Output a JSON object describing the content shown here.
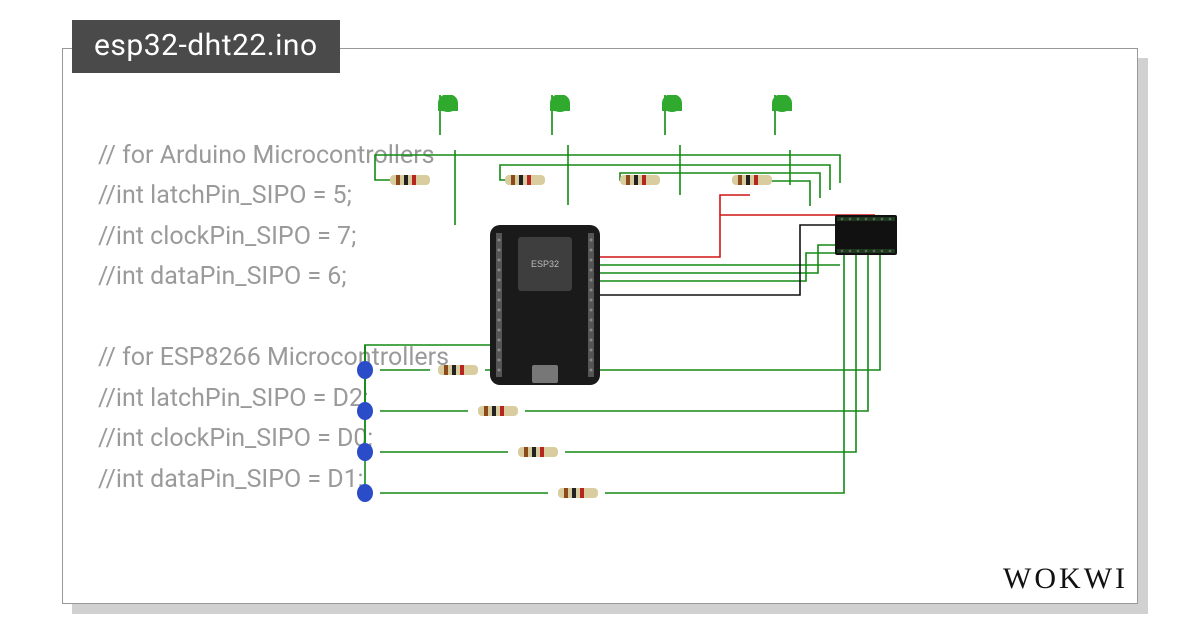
{
  "tab": {
    "title": "esp32-dht22.ino"
  },
  "code": {
    "line1": "// for Arduino Microcontrollers",
    "line2": "//int latchPin_SIPO = 5;",
    "line3": "//int clockPin_SIPO = 7;",
    "line4": "//int dataPin_SIPO = 6;",
    "line5": "",
    "line6": "// for ESP8266 Microcontrollers",
    "line7": "//int latchPin_SIPO = D2;",
    "line8": "//int clockPin_SIPO = D0;",
    "line9": "//int dataPin_SIPO = D1;"
  },
  "brand": "WOKWI",
  "circuit": {
    "board_label": "ESP32",
    "wire_color_signal": "#138a13",
    "wire_color_power": "#d11515",
    "wire_color_gnd": "#111",
    "led_green": "#2faa2f",
    "led_blue": "#2a4cc9",
    "resistor_body": "#d9cda0",
    "resistor_band": "#8a4a1a"
  }
}
